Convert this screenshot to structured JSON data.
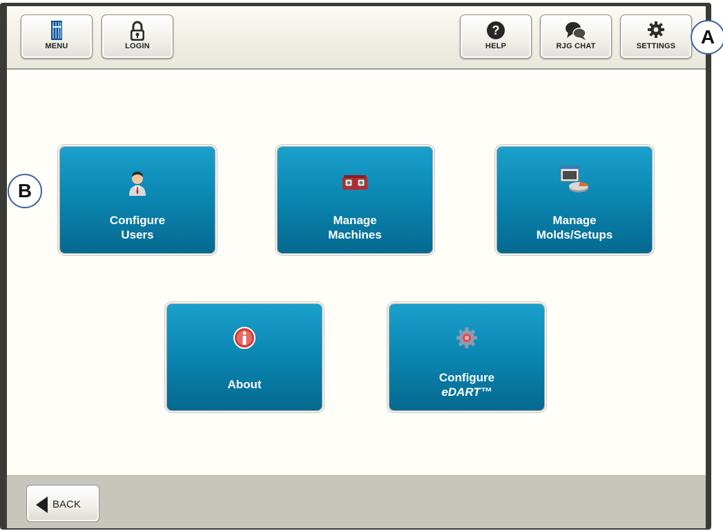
{
  "toolbar": {
    "menu_label": "MENU",
    "login_label": "LOGIN",
    "help_label": "HELP",
    "chat_label": "RJG CHAT",
    "settings_label": "SETTINGS"
  },
  "tiles": {
    "configure_users": {
      "line1": "Configure",
      "line2": "Users",
      "icon": "user-icon"
    },
    "manage_machines": {
      "line1": "Manage",
      "line2": "Machines",
      "icon": "machine-icon"
    },
    "manage_molds": {
      "line1": "Manage",
      "line2": "Molds/Setups",
      "icon": "molds-setups-icon"
    },
    "about": {
      "line1": "About",
      "icon": "info-icon"
    },
    "configure_edart": {
      "line1": "Configure",
      "line2": "eDART™",
      "icon": "gear-icon"
    }
  },
  "footer": {
    "back_label": "BACK"
  },
  "callouts": {
    "a": "A",
    "b": "B"
  },
  "colors": {
    "tile_top": "#1aa0cb",
    "tile_bottom": "#05698f",
    "background": "#fffef8",
    "footer": "#c7c6bd"
  }
}
